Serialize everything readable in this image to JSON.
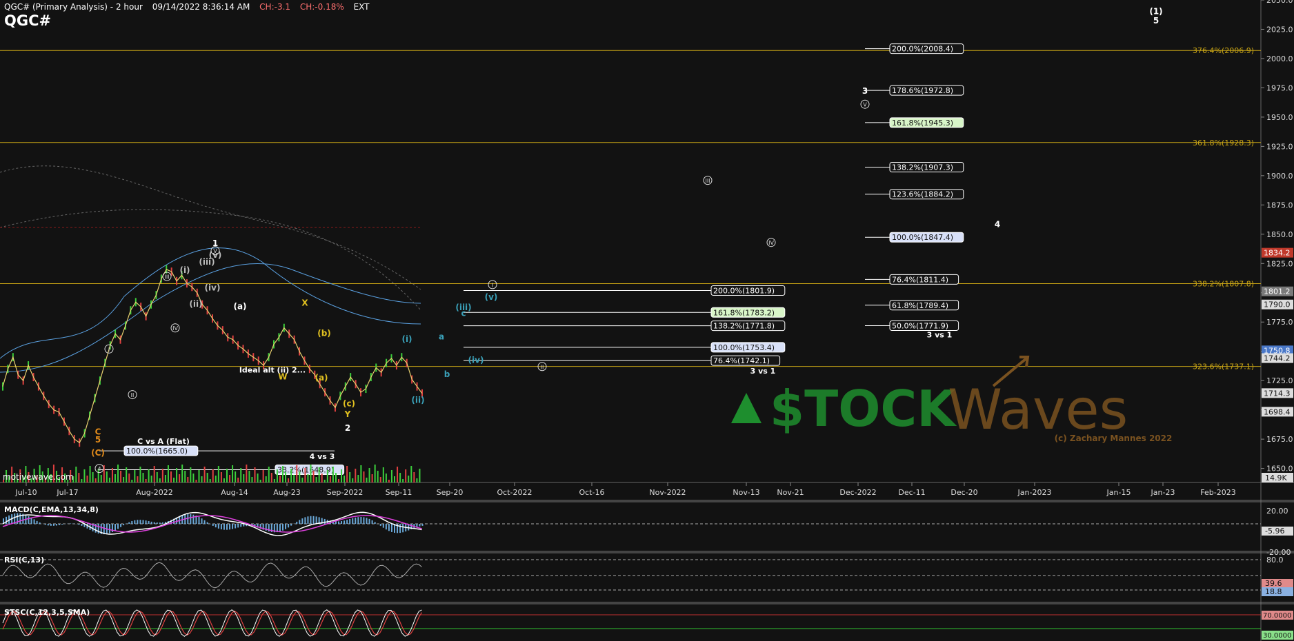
{
  "header": {
    "title": "QGC# (Primary Analysis) - 2 hour",
    "datetime": "09/14/2022 8:36:14 AM",
    "change": "CH:-3.1",
    "change_pct": "CH:-0.18%",
    "session": "EXT",
    "symbol": "QGC#",
    "source": "motivewave.com"
  },
  "watermark": {
    "brand_left": "$TOCK",
    "brand_right": "Waves",
    "copyright": "(c) Zachary Mannes 2022"
  },
  "colors": {
    "background": "#121212",
    "fib_line": "#c8a415",
    "wave_white": "#ffffff",
    "wave_yellow": "#e0c020",
    "wave_orange": "#e08a1a",
    "wave_teal": "#3aa0b8",
    "price_green": "#3ccf3c",
    "price_red": "#e04040",
    "macd_line": "#ffffff",
    "macd_signal": "#e040e0",
    "rsi_line": "#aaaaaa",
    "stoch_k": "#ffffff",
    "stoch_d": "#e04040",
    "watermark_green": "#1e8e2e",
    "watermark_brown": "#7a5220"
  },
  "panels": {
    "macd": {
      "label": "MACD(C,EMA,13,34,8)",
      "axis": [
        "20.00",
        "0.00",
        "-20.00"
      ],
      "current": "-5.96"
    },
    "rsi": {
      "label": "RSI(C,13)",
      "axis": [
        "80.0",
        "20.0"
      ],
      "current_hi": "39.6",
      "current_lo": "18.8"
    },
    "stoch": {
      "label": "STSC(C,12,3,5,SMA)",
      "current_hi": "70.0000",
      "current_lo": "30.0000"
    }
  },
  "chart_data": {
    "type": "line",
    "title": "QGC# (Primary Analysis) - 2 hour",
    "ylim": [
      1638,
      2050
    ],
    "y_ticks": [
      1650,
      1675,
      1700,
      1725,
      1750,
      1775,
      1800,
      1825,
      1850,
      1875,
      1900,
      1925,
      1950,
      1975,
      2000,
      2025,
      2050
    ],
    "y_tick_labels": [
      "1650.0",
      "1675.0",
      "1700.0",
      "1725.0",
      "1750.0",
      "1775.0",
      "1800.0",
      "1825.0",
      "1850.0",
      "1875.0",
      "1900.0",
      "1925.0",
      "1950.0",
      "1975.0",
      "2000.0",
      "2025.0",
      "2050.0"
    ],
    "x_tick_labels": [
      "Jul-10",
      "Jul-17",
      "Aug-2022",
      "Aug-14",
      "Aug-23",
      "Sep-2022",
      "Sep-11",
      "Sep-20",
      "Oct-2022",
      "Oct-16",
      "Nov-2022",
      "Nov-13",
      "Nov-21",
      "Dec-2022",
      "Dec-11",
      "Dec-20",
      "Jan-2023",
      "Jan-15",
      "Jan-23",
      "Feb-2023"
    ],
    "volume_label": "14.9K",
    "price_tags": [
      {
        "text": "1834.2",
        "value": 1834.2,
        "color": "#c0392b"
      },
      {
        "text": "1801.2",
        "value": 1801.2,
        "color": "#7a7a7a"
      },
      {
        "text": "1790.0",
        "value": 1790.0,
        "color": "#dddddd"
      },
      {
        "text": "1750.8",
        "value": 1750.8,
        "color": "#4a78c8"
      },
      {
        "text": "1744.2",
        "value": 1744.2,
        "color": "#dddddd"
      },
      {
        "text": "1714.3",
        "value": 1714.3,
        "color": "#dddddd"
      },
      {
        "text": "1698.4",
        "value": 1698.4,
        "color": "#dddddd"
      }
    ],
    "series": [
      {
        "name": "Price",
        "values": [
          1720,
          1735,
          1745,
          1730,
          1725,
          1738,
          1728,
          1720,
          1712,
          1705,
          1700,
          1698,
          1690,
          1682,
          1675,
          1672,
          1680,
          1695,
          1710,
          1725,
          1740,
          1755,
          1765,
          1760,
          1772,
          1785,
          1792,
          1788,
          1780,
          1790,
          1798,
          1812,
          1820,
          1818,
          1810,
          1815,
          1808,
          1805,
          1800,
          1790,
          1785,
          1778,
          1772,
          1768,
          1762,
          1760,
          1755,
          1752,
          1748,
          1745,
          1742,
          1738,
          1745,
          1756,
          1762,
          1770,
          1765,
          1760,
          1750,
          1742,
          1735,
          1730,
          1722,
          1715,
          1708,
          1702,
          1712,
          1720,
          1728,
          1722,
          1715,
          1718,
          1728,
          1736,
          1732,
          1740,
          1744,
          1738,
          1745,
          1740,
          1726,
          1720,
          1714
        ]
      }
    ],
    "fib_levels": [
      {
        "text": "376.4%(2006.9)",
        "value": 2006.9
      },
      {
        "text": "361.8%(1928.3)",
        "value": 1928.3
      },
      {
        "text": "338.2%(1807.8)",
        "value": 1807.8
      },
      {
        "text": "323.6%(1737.1)",
        "value": 1737.1
      }
    ],
    "extension_boxes": [
      {
        "text": "200.0%(2008.4)",
        "value": 2008.4,
        "style": "dark"
      },
      {
        "text": "178.6%(1972.8)",
        "value": 1972.8,
        "style": "dark"
      },
      {
        "text": "161.8%(1945.3)",
        "value": 1945.3,
        "style": "green"
      },
      {
        "text": "138.2%(1907.3)",
        "value": 1907.3,
        "style": "dark"
      },
      {
        "text": "123.6%(1884.2)",
        "value": 1884.2,
        "style": "dark"
      },
      {
        "text": "100.0%(1847.4)",
        "value": 1847.4,
        "style": "blue"
      },
      {
        "text": "76.4%(1811.4)",
        "value": 1811.4,
        "style": "dark"
      },
      {
        "text": "61.8%(1789.4)",
        "value": 1789.4,
        "style": "dark"
      },
      {
        "text": "50.0%(1771.9)",
        "value": 1771.9,
        "style": "dark"
      }
    ],
    "mid_boxes": [
      {
        "text": "200.0%(1801.9)",
        "value": 1801.9,
        "style": "dark"
      },
      {
        "text": "161.8%(1783.2)",
        "value": 1783.2,
        "style": "green"
      },
      {
        "text": "138.2%(1771.8)",
        "value": 1771.8,
        "style": "dark"
      },
      {
        "text": "100.0%(1753.4)",
        "value": 1753.4,
        "style": "blue"
      },
      {
        "text": "76.4%(1742.1)",
        "value": 1742.1,
        "style": "dark"
      }
    ],
    "left_boxes": [
      {
        "text": "100.0%(1665.0)",
        "value": 1665.0,
        "style": "blue"
      },
      {
        "text": "38.2%(1648.9)",
        "value": 1648.9,
        "style": "blue"
      }
    ],
    "annotations": [
      {
        "text": "C vs A (Flat)",
        "value": 1671
      },
      {
        "text": "4 vs 3",
        "value": 1658
      },
      {
        "text": "3 vs 1",
        "value": 1731
      },
      {
        "text": "3 vs 1",
        "value": 1762
      },
      {
        "text": "Ideal alt (ii) 2...",
        "value": 1732
      }
    ],
    "wave_labels": [
      {
        "text": "1",
        "value": 1840,
        "color": "white"
      },
      {
        "text": "2",
        "value": 1682,
        "color": "white"
      },
      {
        "text": "3",
        "value": 1970,
        "color": "white"
      },
      {
        "text": "4",
        "value": 1856,
        "color": "white"
      },
      {
        "text": "(1)",
        "value": 2038,
        "color": "white"
      },
      {
        "text": "5",
        "value": 2030,
        "color": "white"
      },
      {
        "text": "(C)",
        "value": 1661,
        "color": "orange"
      },
      {
        "text": "5",
        "value": 1672,
        "color": "orange"
      },
      {
        "text": "C",
        "value": 1679,
        "color": "orange"
      },
      {
        "text": "(a)",
        "value": 1786,
        "color": "white"
      },
      {
        "text": "(a)",
        "value": 1725,
        "color": "yellow"
      },
      {
        "text": "(b)",
        "value": 1763,
        "color": "yellow"
      },
      {
        "text": "(c)",
        "value": 1703,
        "color": "yellow"
      },
      {
        "text": "X",
        "value": 1789,
        "color": "yellow"
      },
      {
        "text": "W",
        "value": 1726,
        "color": "yellow"
      },
      {
        "text": "Y",
        "value": 1694,
        "color": "yellow"
      },
      {
        "text": "a",
        "value": 1760,
        "color": "teal"
      },
      {
        "text": "b",
        "value": 1728,
        "color": "teal"
      },
      {
        "text": "c",
        "value": 1780,
        "color": "teal"
      },
      {
        "text": "(iii)",
        "value": 1785,
        "color": "teal"
      },
      {
        "text": "(iv)",
        "value": 1740,
        "color": "teal"
      },
      {
        "text": "(v)",
        "value": 1794,
        "color": "teal"
      },
      {
        "text": "(i)",
        "value": 1758,
        "color": "teal"
      },
      {
        "text": "(ii)",
        "value": 1706,
        "color": "teal"
      },
      {
        "text": "(i)",
        "value": 1817,
        "color": "gray"
      },
      {
        "text": "(ii)",
        "value": 1788,
        "color": "gray"
      },
      {
        "text": "(iii)",
        "value": 1824,
        "color": "gray"
      },
      {
        "text": "(iv)",
        "value": 1802,
        "color": "gray"
      },
      {
        "text": "(v)",
        "value": 1830,
        "color": "gray"
      }
    ],
    "circle_labels": [
      {
        "text": "I",
        "value": 1752,
        "color": "white"
      },
      {
        "text": "II",
        "value": 1713,
        "color": "white"
      },
      {
        "text": "III",
        "value": 1814,
        "color": "white"
      },
      {
        "text": "IV",
        "value": 1770,
        "color": "white"
      },
      {
        "text": "V",
        "value": 1836,
        "color": "white"
      },
      {
        "text": "III",
        "value": 1896,
        "color": "white"
      },
      {
        "text": "IV",
        "value": 1843,
        "color": "white"
      },
      {
        "text": "V",
        "value": 1961,
        "color": "white"
      },
      {
        "text": "I",
        "value": 1807,
        "color": "white"
      },
      {
        "text": "II",
        "value": 1737,
        "color": "white"
      },
      {
        "text": "4",
        "value": 1650,
        "color": "white"
      }
    ]
  }
}
